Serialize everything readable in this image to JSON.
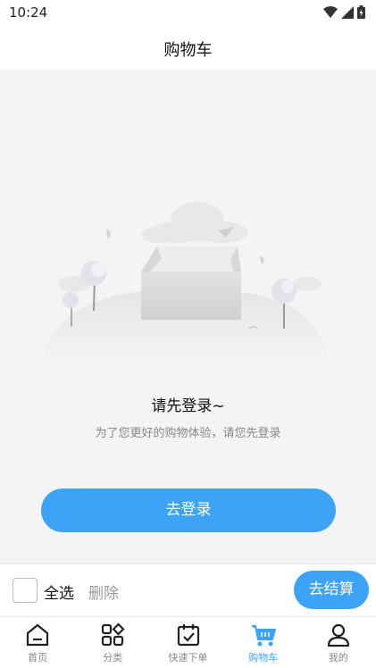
{
  "status_bar": {
    "time": "10:24"
  },
  "header": {
    "title": "购物车"
  },
  "empty_state": {
    "title": "请先登录~",
    "subtitle": "为了您更好的购物体验，请您先登录",
    "login_button": "去登录"
  },
  "cart_actions": {
    "select_all": "全选",
    "delete": "删除",
    "checkout": "去结算"
  },
  "tabs": [
    {
      "label": "首页",
      "icon": "home-icon",
      "active": false
    },
    {
      "label": "分类",
      "icon": "category-icon",
      "active": false
    },
    {
      "label": "快速下单",
      "icon": "quick-order-icon",
      "active": false
    },
    {
      "label": "购物车",
      "icon": "cart-icon",
      "active": true
    },
    {
      "label": "我的",
      "icon": "user-icon",
      "active": false
    }
  ],
  "colors": {
    "accent": "#3ca3f7",
    "background": "#f4f4f4"
  }
}
